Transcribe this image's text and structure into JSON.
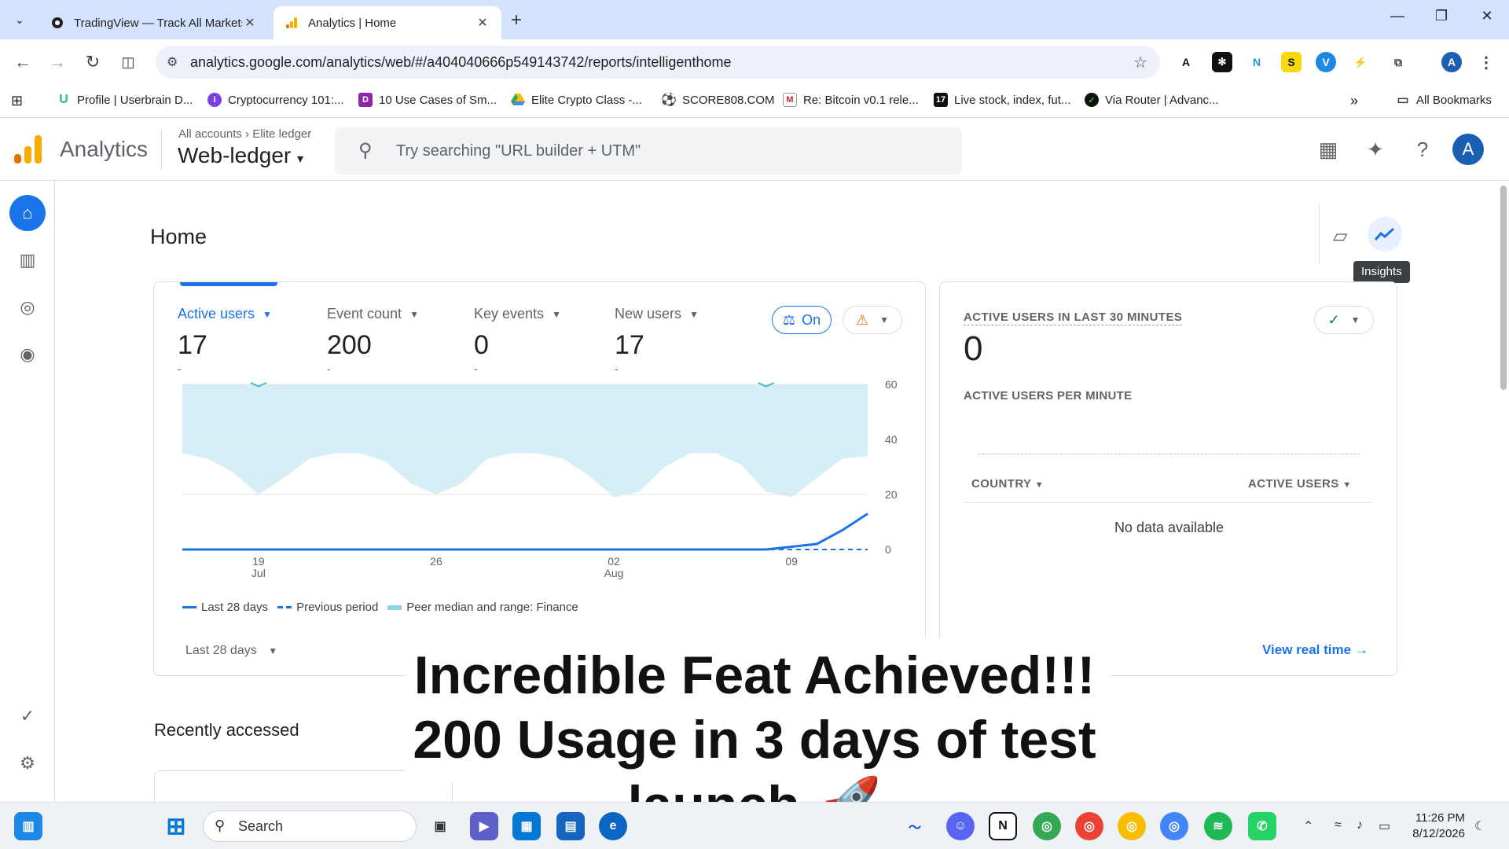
{
  "browser": {
    "tabs": [
      {
        "title": "TradingView — Track All Markets",
        "active": false
      },
      {
        "title": "Analytics | Home",
        "active": true
      }
    ],
    "url": "analytics.google.com/analytics/web/#/a404040666p549143742/reports/intelligenthome",
    "bookmarks": [
      "Profile | Userbrain D...",
      "Cryptocurrency 101:...",
      "10 Use Cases of Sm...",
      "Elite Crypto Class -...",
      "SCORE808.COM",
      "Re: Bitcoin v0.1 rele...",
      "Live stock, index, fut...",
      "Via Router | Advanc..."
    ],
    "all_bookmarks": "All Bookmarks",
    "profile_initial": "A"
  },
  "ga": {
    "product": "Analytics",
    "crumb_accounts": "All accounts",
    "crumb_account": "Elite ledger",
    "property": "Web-ledger",
    "search_placeholder": "Try searching \"URL builder + UTM\"",
    "avatar": "A"
  },
  "page": {
    "title": "Home",
    "tooltip": "Insights"
  },
  "metrics": [
    {
      "label": "Active users",
      "value": "17",
      "delta": "-"
    },
    {
      "label": "Event count",
      "value": "200",
      "delta": "-"
    },
    {
      "label": "Key events",
      "value": "0",
      "delta": "-"
    },
    {
      "label": "New users",
      "value": "17",
      "delta": "-"
    }
  ],
  "chips": {
    "on_label": "On"
  },
  "chart_data": {
    "type": "line",
    "x_ticks": [
      {
        "day": "19",
        "month": "Jul"
      },
      {
        "day": "26",
        "month": ""
      },
      {
        "day": "02",
        "month": "Aug"
      },
      {
        "day": "09",
        "month": ""
      }
    ],
    "y_ticks": [
      "60",
      "40",
      "20",
      "0"
    ],
    "ylim": [
      0,
      60
    ],
    "series": [
      {
        "name": "Last 28 days",
        "values": [
          0,
          0,
          0,
          0,
          0,
          0,
          0,
          0,
          0,
          0,
          0,
          0,
          0,
          0,
          0,
          0,
          0,
          0,
          0,
          0,
          0,
          0,
          0,
          0,
          1,
          2,
          7,
          13
        ]
      },
      {
        "name": "Previous period",
        "values": [
          0,
          0,
          0,
          0,
          0,
          0,
          0,
          0,
          0,
          0,
          0,
          0,
          0,
          0,
          0,
          0,
          0,
          0,
          0,
          0,
          0,
          0,
          0,
          0,
          0,
          0,
          0,
          0
        ]
      },
      {
        "name": "Peer median and range: Finance",
        "upper": [
          62,
          62,
          62,
          62,
          62,
          62,
          62,
          62,
          62,
          62,
          62,
          62,
          62,
          62,
          62,
          62,
          62,
          62,
          62,
          62,
          62,
          62,
          62,
          62,
          62,
          62,
          62,
          62
        ],
        "lower": [
          35,
          33,
          28,
          20,
          26,
          33,
          35,
          35,
          32,
          24,
          20,
          24,
          33,
          35,
          35,
          33,
          27,
          19,
          21,
          30,
          35,
          35,
          31,
          21,
          19,
          26,
          33,
          34
        ],
        "median": [
          null,
          null,
          null,
          61,
          null,
          null,
          null,
          null,
          null,
          null,
          null,
          null,
          null,
          null,
          null,
          null,
          null,
          null,
          null,
          null,
          null,
          null,
          null,
          61,
          null,
          null,
          null,
          null
        ]
      }
    ],
    "grid": true,
    "legend_position": "bottom-left"
  },
  "legend": [
    "Last 28 days",
    "Previous period",
    "Peer median and range: Finance"
  ],
  "range_label": "Last 28 days",
  "realtime": {
    "title": "ACTIVE USERS IN LAST 30 MINUTES",
    "value": "0",
    "per_minute": "ACTIVE USERS PER MINUTE",
    "col_country": "COUNTRY",
    "col_users": "ACTIVE USERS",
    "no_data": "No data available",
    "link": "View real time"
  },
  "recent": {
    "title": "Recently accessed"
  },
  "caption": {
    "line1": "Incredible Feat Achieved!!!",
    "line2": "200 Usage in 3 days of test",
    "line3": "launch 🚀"
  },
  "taskbar": {
    "search_label": "Search",
    "time": "11:26 PM",
    "date": "8/12/2026"
  },
  "colors": {
    "accent": "#1a73e8",
    "peer_band": "#d6eef6",
    "chrome_bg": "#d3e3fd"
  }
}
